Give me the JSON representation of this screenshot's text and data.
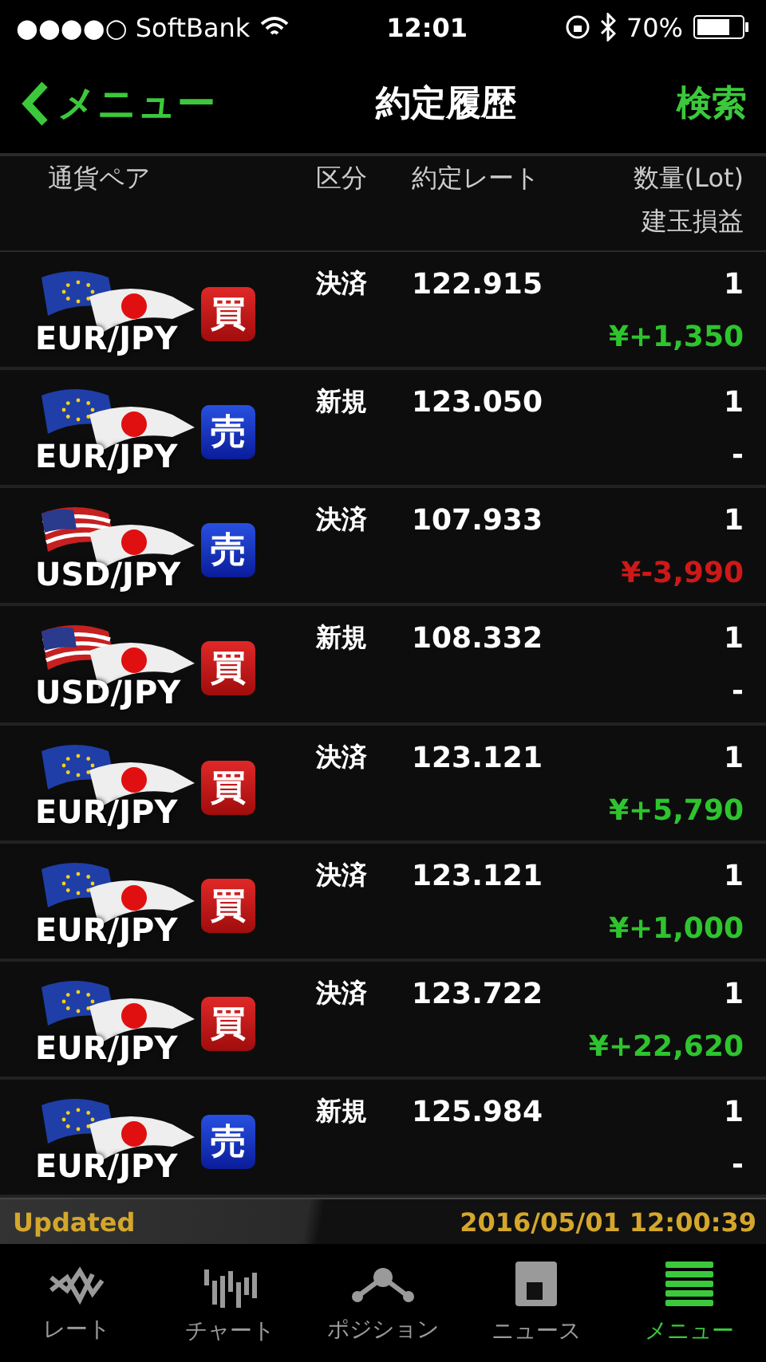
{
  "status_bar": {
    "carrier": "●●●●○ SoftBank",
    "time": "12:01",
    "battery": "70%"
  },
  "nav": {
    "back": "メニュー",
    "title": "約定履歴",
    "action": "検索"
  },
  "columns": {
    "pair": "通貨ペア",
    "type": "区分",
    "rate": "約定レート",
    "qty": "数量(Lot)",
    "pnl": "建玉損益"
  },
  "rows": [
    {
      "kind": "eur",
      "pair": "EUR/JPY",
      "badge": {
        "kind": "buy",
        "label": "買"
      },
      "type": "決済",
      "rate": "122.915",
      "qty": "1",
      "pnl": "¥+1,350",
      "color": "#2ec42e"
    },
    {
      "kind": "eur",
      "pair": "EUR/JPY",
      "badge": {
        "kind": "sell",
        "label": "売"
      },
      "type": "新規",
      "rate": "123.050",
      "qty": "1",
      "pnl": "-",
      "color": "#ffffff"
    },
    {
      "kind": "usd",
      "pair": "USD/JPY",
      "badge": {
        "kind": "sell",
        "label": "売"
      },
      "type": "決済",
      "rate": "107.933",
      "qty": "1",
      "pnl": "¥-3,990",
      "color": "#d01818"
    },
    {
      "kind": "usd",
      "pair": "USD/JPY",
      "badge": {
        "kind": "buy",
        "label": "買"
      },
      "type": "新規",
      "rate": "108.332",
      "qty": "1",
      "pnl": "-",
      "color": "#ffffff"
    },
    {
      "kind": "eur",
      "pair": "EUR/JPY",
      "badge": {
        "kind": "buy",
        "label": "買"
      },
      "type": "決済",
      "rate": "123.121",
      "qty": "1",
      "pnl": "¥+5,790",
      "color": "#2ec42e"
    },
    {
      "kind": "eur",
      "pair": "EUR/JPY",
      "badge": {
        "kind": "buy",
        "label": "買"
      },
      "type": "決済",
      "rate": "123.121",
      "qty": "1",
      "pnl": "¥+1,000",
      "color": "#2ec42e"
    },
    {
      "kind": "eur",
      "pair": "EUR/JPY",
      "badge": {
        "kind": "buy",
        "label": "買"
      },
      "type": "決済",
      "rate": "123.722",
      "qty": "1",
      "pnl": "¥+22,620",
      "color": "#2ec42e"
    },
    {
      "kind": "eur",
      "pair": "EUR/JPY",
      "badge": {
        "kind": "sell",
        "label": "売"
      },
      "type": "新規",
      "rate": "125.984",
      "qty": "1",
      "pnl": "-",
      "color": "#ffffff"
    }
  ],
  "updated": {
    "label": "Updated",
    "time": "2016/05/01 12:00:39"
  },
  "tabs": [
    {
      "kind": "rate",
      "label": "レート",
      "selected": false
    },
    {
      "kind": "chart",
      "label": "チャート",
      "selected": false
    },
    {
      "kind": "position",
      "label": "ポジション",
      "selected": false
    },
    {
      "kind": "news",
      "label": "ニュース",
      "selected": false
    },
    {
      "kind": "menu",
      "label": "メニュー",
      "selected": true
    }
  ]
}
